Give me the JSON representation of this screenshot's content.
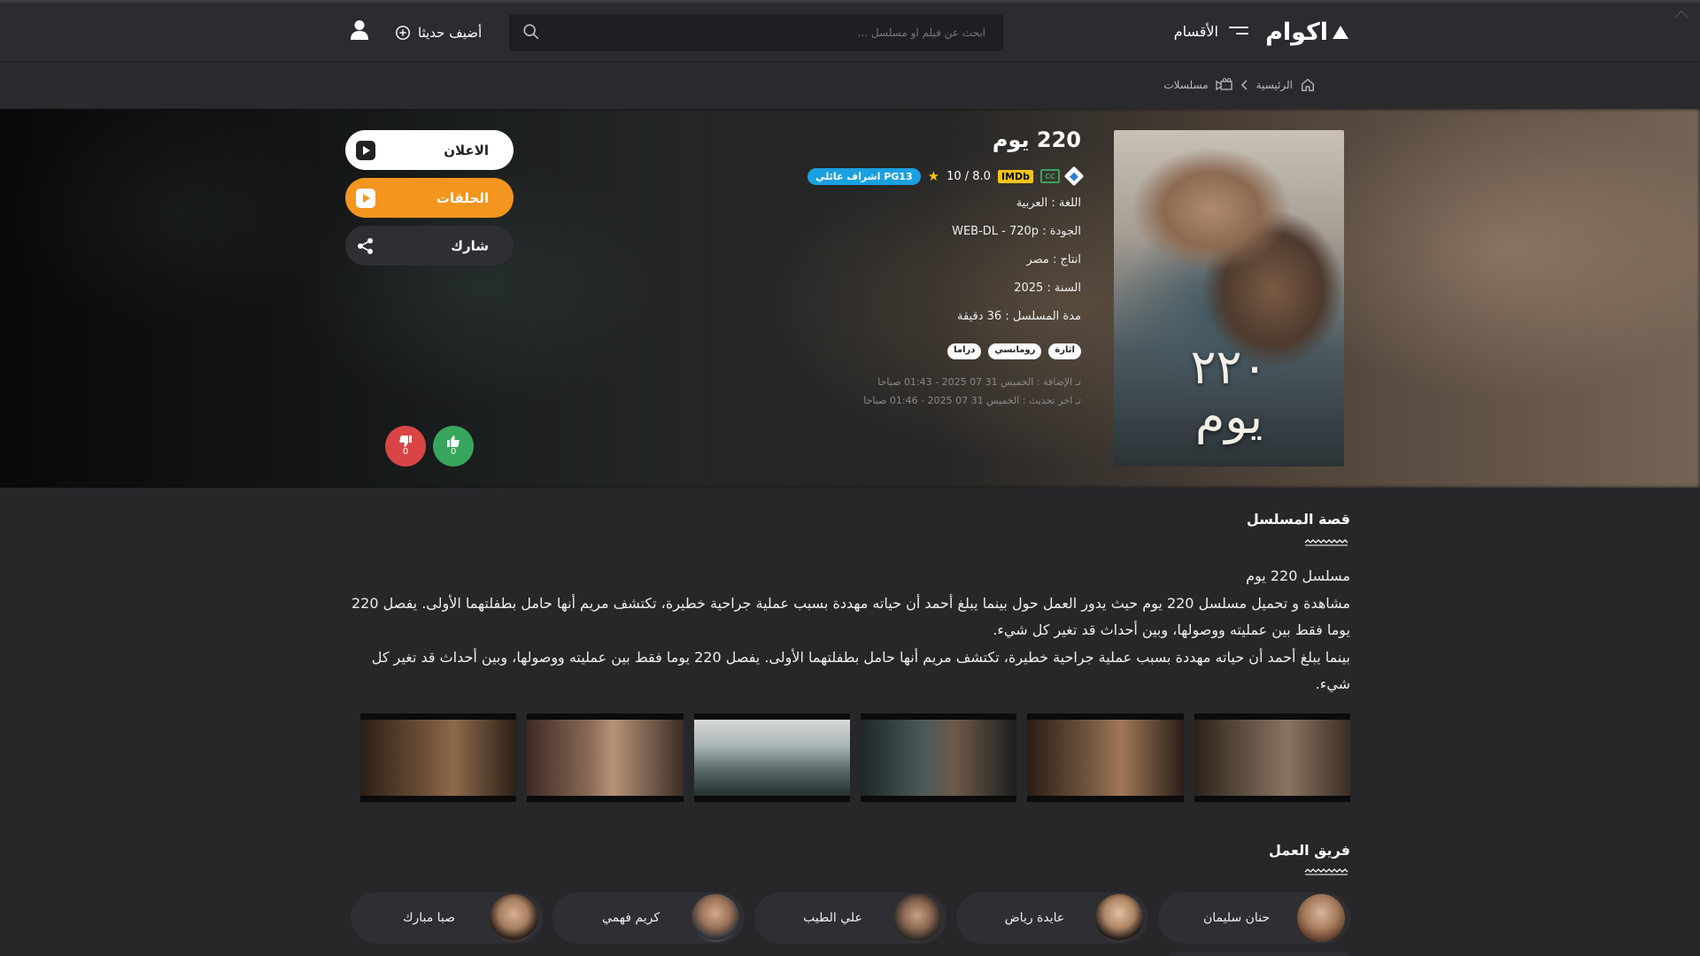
{
  "header": {
    "logo_text": "اكوام",
    "sections_label": "الأقسام",
    "search_placeholder": "ابحث عن فيلم او مسلسل ...",
    "added_label": "أضيف حديثا"
  },
  "breadcrumb": {
    "home": "الرئيسية",
    "category": "مسلسلات"
  },
  "show": {
    "poster_title": "٢٢٠ يوم",
    "title": "220 يوم",
    "rating_text": "8.0 / 10",
    "imdb_label": "IMDb",
    "pg_badge": "PG13 اشراف عائلي",
    "language": "اللغة : العربية",
    "quality": "الجودة : WEB-DL - 720p",
    "production": "انتاج : مصر",
    "year": "السنة : 2025",
    "duration": "مدة المسلسل : 36 دقيقة",
    "tags": [
      "اثارة",
      "رومانسي",
      "دراما"
    ],
    "added_date": "تـ الإضافة : الخميس 31 07 2025 - 01:43 صباحا",
    "updated_date": "تـ اخر تحديث : الخميس 31 07 2025 - 01:46 صباحا"
  },
  "actions": {
    "trailer": "الاعلان",
    "episodes": "الحلقات",
    "share": "شارك",
    "likes": "0",
    "dislikes": "0"
  },
  "story": {
    "section_title": "قصة المسلسل",
    "line1": "مسلسل 220 يوم",
    "para1": "مشاهدة و تحميل مسلسل 220 يوم حيث يدور العمل حول بينما يبلغ أحمد أن حياته مهددة بسبب عملية جراحية خطيرة، تكتشف مريم أنها حامل بطفلتهما الأولى. يفصل 220 يوما فقط بين عمليته ووصولها، وبين أحداث قد تغير كل شيء.",
    "para2": "بينما يبلغ أحمد أن حياته مهددة بسبب عملية جراحية خطيرة، تكتشف مريم أنها حامل بطفلتهما الأولى. يفصل 220 يوما فقط بين عمليته ووصولها، وبين أحداث قد تغير كل شيء."
  },
  "cast": {
    "section_title": "فريق العمل",
    "members": [
      "حنان سليمان",
      "عايدة رياض",
      "علي الطيب",
      "كريم فهمي",
      "صبا مبارك"
    ]
  },
  "colors": {
    "accent_orange": "#f3951f",
    "like_green": "#37a55c",
    "dislike_red": "#d94545",
    "pg_blue": "#1aa0e0",
    "imdb_yellow": "#f5c518"
  }
}
